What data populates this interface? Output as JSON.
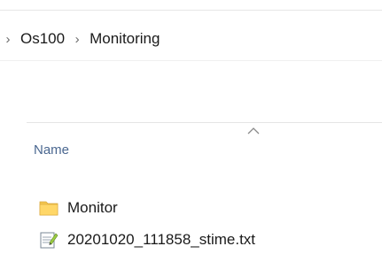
{
  "breadcrumb": {
    "items": [
      "Os100",
      "Monitoring"
    ]
  },
  "list": {
    "columns": {
      "name": "Name"
    },
    "sort": "ascending",
    "items": [
      {
        "name": "Monitor",
        "icon": "folder-icon"
      },
      {
        "name": "20201020_111858_stime.txt",
        "icon": "text-file-icon"
      }
    ]
  }
}
